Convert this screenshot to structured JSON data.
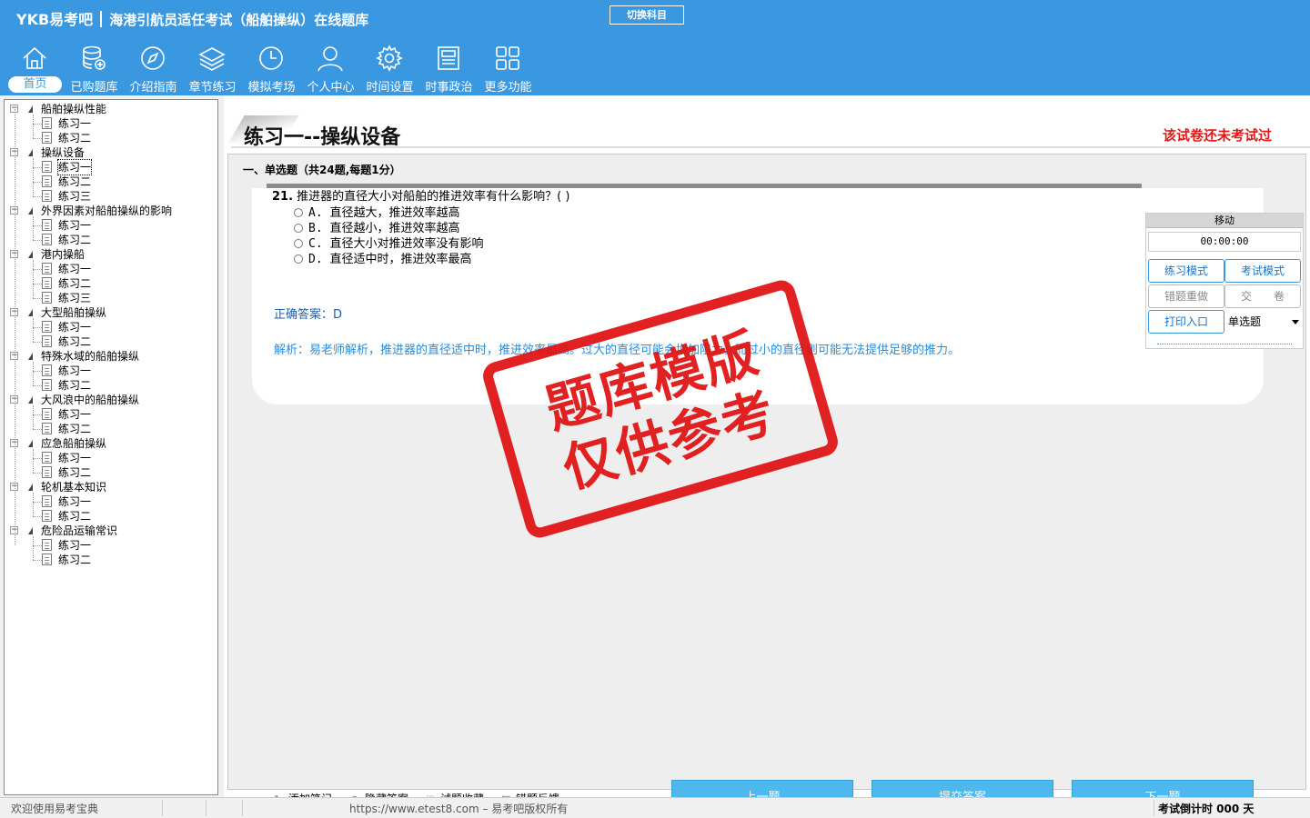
{
  "header": {
    "logo": "YKB易考吧",
    "title": "海港引航员适任考试（船舶操纵）在线题库",
    "switch_button": "切换科目",
    "nav": [
      {
        "label": "首页",
        "icon": "home-icon"
      },
      {
        "label": "已购题库",
        "icon": "database-icon"
      },
      {
        "label": "介绍指南",
        "icon": "compass-icon"
      },
      {
        "label": "章节练习",
        "icon": "layers-icon"
      },
      {
        "label": "模拟考场",
        "icon": "clock-icon"
      },
      {
        "label": "个人中心",
        "icon": "user-icon"
      },
      {
        "label": "时间设置",
        "icon": "gear-icon"
      },
      {
        "label": "时事政治",
        "icon": "news-icon"
      },
      {
        "label": "更多功能",
        "icon": "grid-icon"
      }
    ]
  },
  "tree": [
    {
      "label": "船舶操纵性能",
      "children": [
        "练习一",
        "练习二"
      ]
    },
    {
      "label": "操纵设备",
      "children": [
        "练习一",
        "练习二",
        "练习三"
      ]
    },
    {
      "label": "外界因素对船舶操纵的影响",
      "children": [
        "练习一",
        "练习二"
      ]
    },
    {
      "label": "港内操船",
      "children": [
        "练习一",
        "练习二",
        "练习三"
      ]
    },
    {
      "label": "大型船舶操纵",
      "children": [
        "练习一",
        "练习二"
      ]
    },
    {
      "label": "特殊水域的船舶操纵",
      "children": [
        "练习一",
        "练习二"
      ]
    },
    {
      "label": "大风浪中的船舶操纵",
      "children": [
        "练习一",
        "练习二"
      ]
    },
    {
      "label": "应急船舶操纵",
      "children": [
        "练习一",
        "练习二"
      ]
    },
    {
      "label": "轮机基本知识",
      "children": [
        "练习一",
        "练习二"
      ]
    },
    {
      "label": "危险品运输常识",
      "children": [
        "练习一",
        "练习二"
      ]
    }
  ],
  "main": {
    "paper_title": "练习一--操纵设备",
    "status_notice": "该试卷还未考试过",
    "section_title": "一、单选题（共24题,每题1分）",
    "question": {
      "number": "21.",
      "text": "推进器的直径大小对船舶的推进效率有什么影响？( )",
      "options": [
        "A. 直径越大，推进效率越高",
        "B. 直径越小，推进效率越高",
        "C. 直径大小对推进效率没有影响",
        "D. 直径适中时，推进效率最高"
      ],
      "answer": "正确答案：D",
      "analysis": "解析：易老师解析，推进器的直径适中时，推进效率最高。过大的直径可能会增加阻力，而过小的直径则可能无法提供足够的推力。"
    },
    "tools": [
      "添加笔记",
      "隐藏答案",
      "试题收藏",
      "错题反馈"
    ],
    "buttons": {
      "prev": "上一题",
      "submit": "提交答案",
      "next": "下一题"
    },
    "scroll_grip": "|||"
  },
  "widget": {
    "move": "移动",
    "timer": "00:00:00",
    "practice_mode": "练习模式",
    "exam_mode": "考试模式",
    "redo_wrong": "错题重做",
    "hand_in": "交　　卷",
    "print": "打印入口",
    "type_select": "单选题"
  },
  "stamp": {
    "line1": "题库模版",
    "line2": "仅供参考"
  },
  "status": {
    "welcome": "欢迎使用易考宝典",
    "copyright": "https://www.etest8.com – 易考吧版权所有",
    "countdown": "考试倒计时 000 天"
  },
  "colors": {
    "header": "#3a98e0",
    "accent_red": "#e01818",
    "button": "#4cb8ee"
  }
}
